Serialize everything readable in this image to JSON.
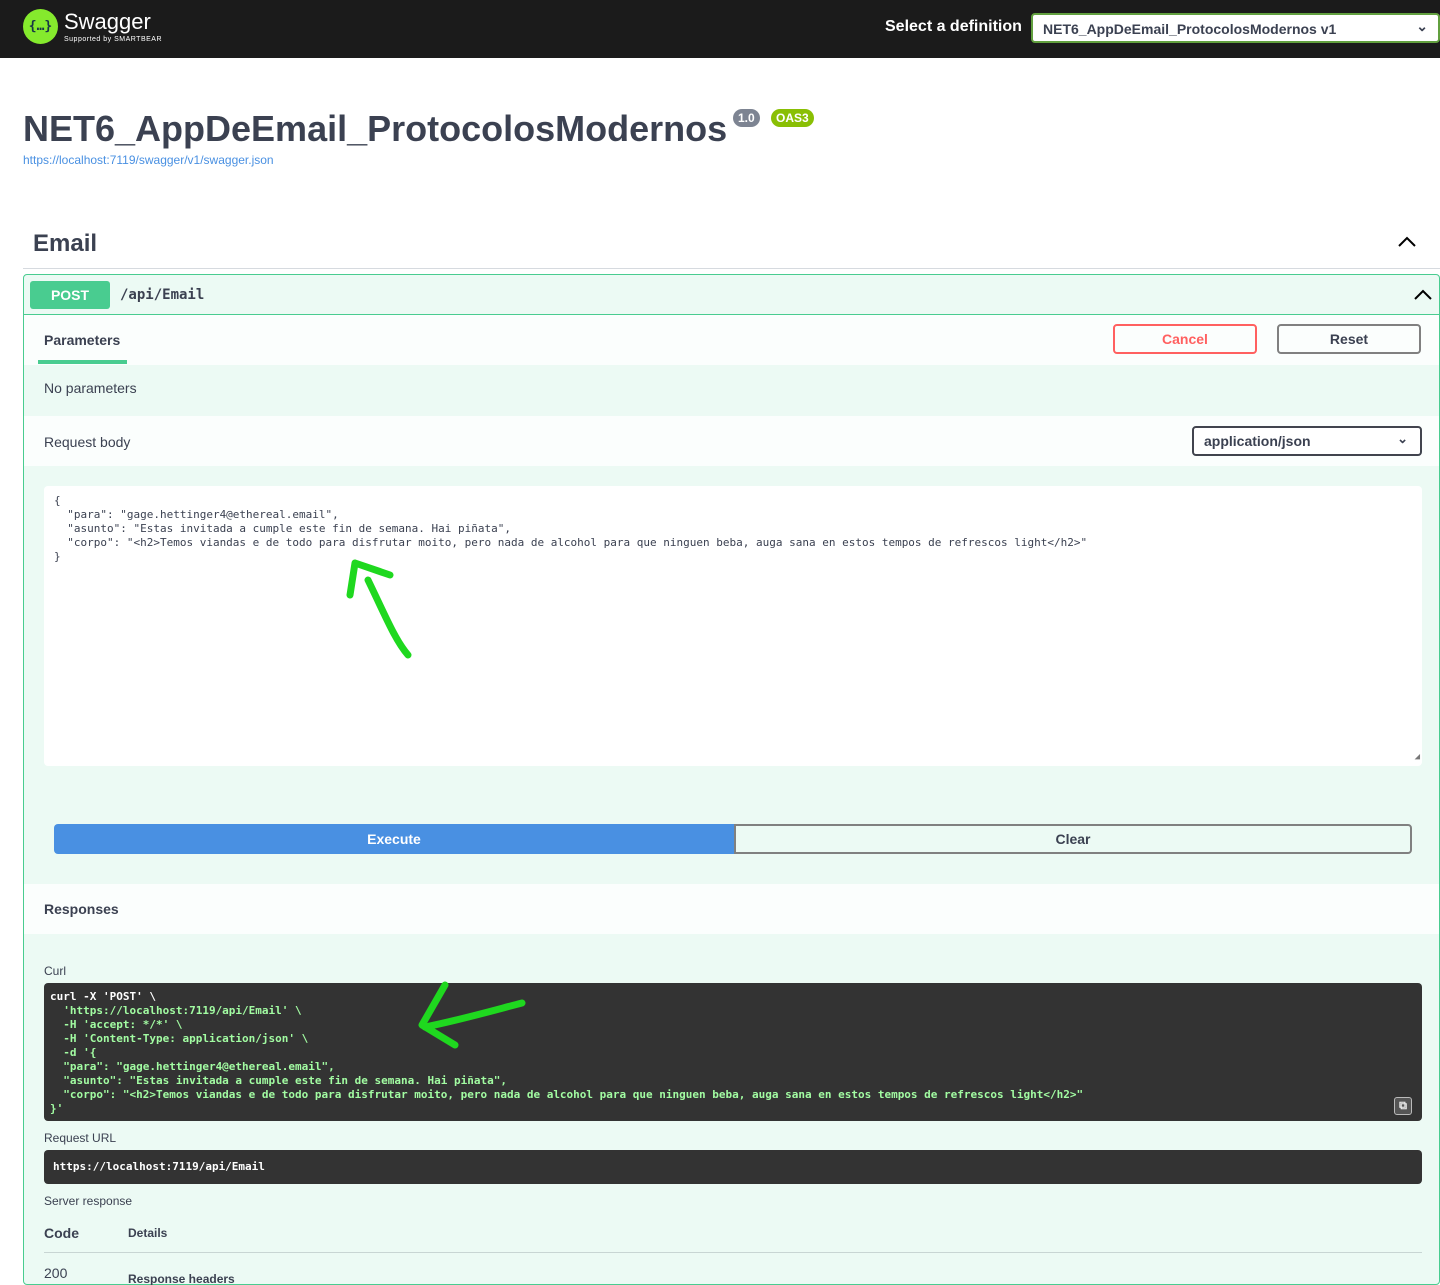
{
  "topbar": {
    "logo_title": "Swagger",
    "logo_sub": "Supported by SMARTBEAR",
    "definition_label": "Select a definition",
    "definition_value": "NET6_AppDeEmail_ProtocolosModernos v1"
  },
  "info": {
    "title": "NET6_AppDeEmail_ProtocolosModernos",
    "version": "1.0",
    "oas": "OAS3",
    "spec_url": "https://localhost:7119/swagger/v1/swagger.json"
  },
  "tag": {
    "name": "Email"
  },
  "operation": {
    "method": "POST",
    "path": "/api/Email",
    "parameters_tab": "Parameters",
    "cancel_label": "Cancel",
    "reset_label": "Reset",
    "no_parameters": "No parameters",
    "request_body_label": "Request body",
    "content_type": "application/json",
    "request_body": "{\n  \"para\": \"gage.hettinger4@ethereal.email\",\n  \"asunto\": \"Estas invitada a cumple este fin de semana. Hai piñata\",\n  \"corpo\": \"<h2>Temos viandas e de todo para disfrutar moito, pero nada de alcohol para que ninguen beba, auga sana en estos tempos de refrescos light</h2>\"\n}",
    "execute_label": "Execute",
    "clear_label": "Clear"
  },
  "responses": {
    "title": "Responses",
    "curl_label": "Curl",
    "curl_lines": [
      "curl -X 'POST' \\",
      "  'https://localhost:7119/api/Email' \\",
      "  -H 'accept: */*' \\",
      "  -H 'Content-Type: application/json' \\",
      "  -d '{",
      "  \"para\": \"gage.hettinger4@ethereal.email\",",
      "  \"asunto\": \"Estas invitada a cumple este fin de semana. Hai piñata\",",
      "  \"corpo\": \"<h2>Temos viandas e de todo para disfrutar moito, pero nada de alcohol para que ninguen beba, auga sana en estos tempos de refrescos light</h2>\"",
      "}'"
    ],
    "request_url_label": "Request URL",
    "request_url": "https://localhost:7119/api/Email",
    "server_response_label": "Server response",
    "code_header": "Code",
    "details_header": "Details",
    "code": "200",
    "response_headers_label": "Response headers"
  },
  "colors": {
    "post_green": "#49cc90",
    "execute_blue": "#4990e2",
    "cancel_red": "#ff6060",
    "annotation_green": "#1fd81f"
  },
  "icons": [
    "swagger-logo-icon",
    "chevron-down-icon",
    "chevron-up-icon",
    "copy-icon",
    "resize-grip-icon"
  ]
}
